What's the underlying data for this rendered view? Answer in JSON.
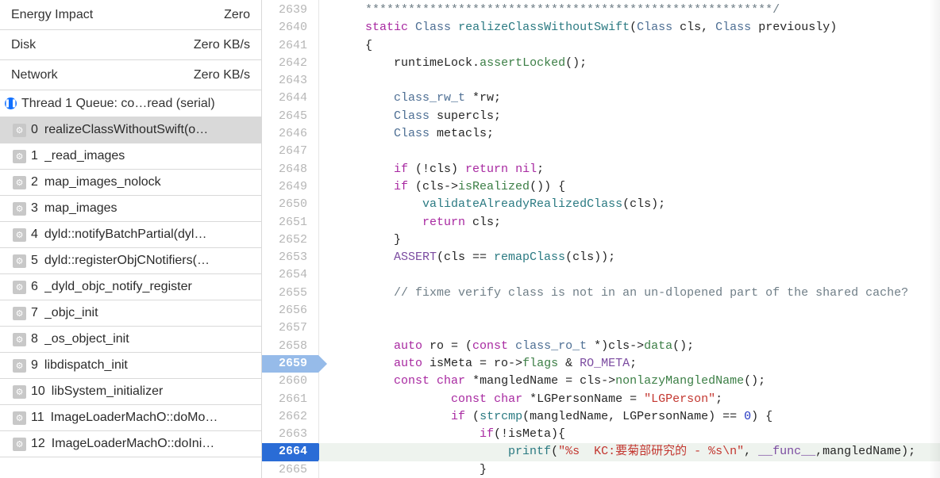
{
  "sidebar": {
    "gauges": [
      {
        "label": "Energy Impact",
        "value": "Zero"
      },
      {
        "label": "Disk",
        "value": "Zero KB/s"
      },
      {
        "label": "Network",
        "value": "Zero KB/s"
      }
    ],
    "thread_header": "Thread 1 Queue: co…read (serial)",
    "stack": [
      {
        "num": "0",
        "label": "realizeClassWithoutSwift(o…",
        "selected": true
      },
      {
        "num": "1",
        "label": "_read_images"
      },
      {
        "num": "2",
        "label": "map_images_nolock"
      },
      {
        "num": "3",
        "label": "map_images"
      },
      {
        "num": "4",
        "label": "dyld::notifyBatchPartial(dyl…"
      },
      {
        "num": "5",
        "label": "dyld::registerObjCNotifiers(…"
      },
      {
        "num": "6",
        "label": "_dyld_objc_notify_register"
      },
      {
        "num": "7",
        "label": "_objc_init"
      },
      {
        "num": "8",
        "label": "_os_object_init"
      },
      {
        "num": "9",
        "label": "libdispatch_init"
      },
      {
        "num": "10",
        "label": "libSystem_initializer"
      },
      {
        "num": "11",
        "label": "ImageLoaderMachO::doMo…"
      },
      {
        "num": "12",
        "label": "ImageLoaderMachO::doIni…"
      }
    ]
  },
  "gutter": {
    "start": 2639,
    "end": 2665,
    "marker_light": 2659,
    "marker_dark": 2664
  },
  "code_line_highlighted": 2664,
  "code": {
    "l2639": {
      "indent": 1,
      "tokens": [
        {
          "t": "*********************************************************",
          "cls": "cm"
        },
        {
          "t": "/",
          "cls": "cm"
        }
      ]
    },
    "l2640": {
      "indent": 1,
      "tokens": [
        {
          "t": "static",
          "cls": "kw"
        },
        {
          "t": " "
        },
        {
          "t": "Class",
          "cls": "typ"
        },
        {
          "t": " "
        },
        {
          "t": "realizeClassWithoutSwift",
          "cls": "fn"
        },
        {
          "t": "("
        },
        {
          "t": "Class",
          "cls": "typ"
        },
        {
          "t": " cls, "
        },
        {
          "t": "Class",
          "cls": "typ"
        },
        {
          "t": " previously)"
        }
      ]
    },
    "l2641": {
      "indent": 1,
      "tokens": [
        {
          "t": "{"
        }
      ]
    },
    "l2642": {
      "indent": 2,
      "tokens": [
        {
          "t": "runtimeLock",
          "cls": "id"
        },
        {
          "t": "."
        },
        {
          "t": "assertLocked",
          "cls": "fn2"
        },
        {
          "t": "();"
        }
      ]
    },
    "l2643": {
      "indent": 1,
      "tokens": []
    },
    "l2644": {
      "indent": 2,
      "tokens": [
        {
          "t": "class_rw_t",
          "cls": "typ"
        },
        {
          "t": " *rw;"
        }
      ]
    },
    "l2645": {
      "indent": 2,
      "tokens": [
        {
          "t": "Class",
          "cls": "typ"
        },
        {
          "t": " supercls;"
        }
      ]
    },
    "l2646": {
      "indent": 2,
      "tokens": [
        {
          "t": "Class",
          "cls": "typ"
        },
        {
          "t": " metacls;"
        }
      ]
    },
    "l2647": {
      "indent": 2,
      "tokens": []
    },
    "l2648": {
      "indent": 2,
      "tokens": [
        {
          "t": "if",
          "cls": "kw"
        },
        {
          "t": " (!cls) "
        },
        {
          "t": "return",
          "cls": "kw"
        },
        {
          "t": " "
        },
        {
          "t": "nil",
          "cls": "lit"
        },
        {
          "t": ";"
        }
      ]
    },
    "l2649": {
      "indent": 2,
      "tokens": [
        {
          "t": "if",
          "cls": "kw"
        },
        {
          "t": " (cls->"
        },
        {
          "t": "isRealized",
          "cls": "fn2"
        },
        {
          "t": "()) {"
        }
      ]
    },
    "l2650": {
      "indent": 3,
      "tokens": [
        {
          "t": "validateAlreadyRealizedClass",
          "cls": "fn"
        },
        {
          "t": "(cls);"
        }
      ]
    },
    "l2651": {
      "indent": 3,
      "tokens": [
        {
          "t": "return",
          "cls": "kw"
        },
        {
          "t": " cls;"
        }
      ]
    },
    "l2652": {
      "indent": 2,
      "tokens": [
        {
          "t": "}"
        }
      ]
    },
    "l2653": {
      "indent": 2,
      "tokens": [
        {
          "t": "ASSERT",
          "cls": "mac"
        },
        {
          "t": "(cls == "
        },
        {
          "t": "remapClass",
          "cls": "fn"
        },
        {
          "t": "(cls));"
        }
      ]
    },
    "l2654": {
      "indent": 2,
      "tokens": []
    },
    "l2655": {
      "indent": 2,
      "tokens": [
        {
          "t": "// fixme verify class is not in an un-dlopened part of the shared cache?",
          "cls": "cm"
        }
      ]
    },
    "l2656": {
      "indent": 2,
      "tokens": []
    },
    "l2657": {
      "indent": 2,
      "tokens": []
    },
    "l2658": {
      "indent": 2,
      "tokens": [
        {
          "t": "auto",
          "cls": "kw"
        },
        {
          "t": " ro = ("
        },
        {
          "t": "const",
          "cls": "kw"
        },
        {
          "t": " "
        },
        {
          "t": "class_ro_t",
          "cls": "typ"
        },
        {
          "t": " *)cls->"
        },
        {
          "t": "data",
          "cls": "fn2"
        },
        {
          "t": "();"
        }
      ]
    },
    "l2659": {
      "indent": 2,
      "tokens": [
        {
          "t": "auto",
          "cls": "kw"
        },
        {
          "t": " isMeta = ro->"
        },
        {
          "t": "flags",
          "cls": "fn2"
        },
        {
          "t": " & "
        },
        {
          "t": "RO_META",
          "cls": "mac"
        },
        {
          "t": ";"
        }
      ]
    },
    "l2660": {
      "indent": 2,
      "tokens": [
        {
          "t": "const",
          "cls": "kw"
        },
        {
          "t": " "
        },
        {
          "t": "char",
          "cls": "kw"
        },
        {
          "t": " *mangledName = cls->"
        },
        {
          "t": "nonlazyMangledName",
          "cls": "fn2"
        },
        {
          "t": "();"
        }
      ]
    },
    "l2661": {
      "indent": 4,
      "tokens": [
        {
          "t": "const",
          "cls": "kw"
        },
        {
          "t": " "
        },
        {
          "t": "char",
          "cls": "kw"
        },
        {
          "t": " *LGPersonName = "
        },
        {
          "t": "\"LGPerson\"",
          "cls": "str"
        },
        {
          "t": ";"
        }
      ]
    },
    "l2662": {
      "indent": 4,
      "tokens": [
        {
          "t": "if",
          "cls": "kw"
        },
        {
          "t": " ("
        },
        {
          "t": "strcmp",
          "cls": "fn"
        },
        {
          "t": "(mangledName, LGPersonName) == "
        },
        {
          "t": "0",
          "cls": "num"
        },
        {
          "t": ") {"
        }
      ]
    },
    "l2663": {
      "indent": 5,
      "tokens": [
        {
          "t": "if",
          "cls": "kw"
        },
        {
          "t": "(!isMeta){"
        }
      ]
    },
    "l2664": {
      "indent": 6,
      "tokens": [
        {
          "t": "printf",
          "cls": "fn"
        },
        {
          "t": "("
        },
        {
          "t": "\"%s  KC:要菊部研究的 - %s\\n\"",
          "cls": "str"
        },
        {
          "t": ", "
        },
        {
          "t": "__func__",
          "cls": "mac"
        },
        {
          "t": ",mangledName);"
        }
      ]
    },
    "l2665": {
      "indent": 5,
      "tokens": [
        {
          "t": "}"
        }
      ]
    }
  }
}
